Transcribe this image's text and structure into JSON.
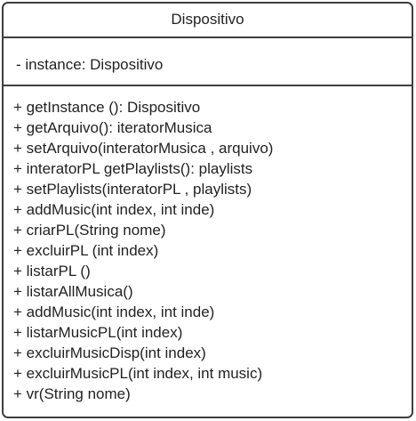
{
  "uml_class": {
    "name": "Dispositivo",
    "attributes": [
      "- instance: Dispositivo"
    ],
    "methods": [
      "+ getInstance (): Dispositivo",
      "+ getArquivo(): iteratorMusica",
      "+ setArquivo(interatorMusica , arquivo)",
      "+ interatorPL getPlaylists(): playlists",
      "+ setPlaylists(interatorPL , playlists)",
      "+ addMusic(int index, int inde)",
      "+ criarPL(String nome)",
      "+ excluirPL (int index)",
      "+ listarPL ()",
      "+ listarAllMusica()",
      "+ addMusic(int index, int inde)",
      "+ listarMusicPL(int index)",
      "+ excluirMusicDisp(int index)",
      "+ excluirMusicPL(int index, int music)",
      "+ vr(String nome)"
    ]
  },
  "colors": {
    "border": "#3f3f3f",
    "text": "#222222",
    "background": "#ffffff"
  }
}
